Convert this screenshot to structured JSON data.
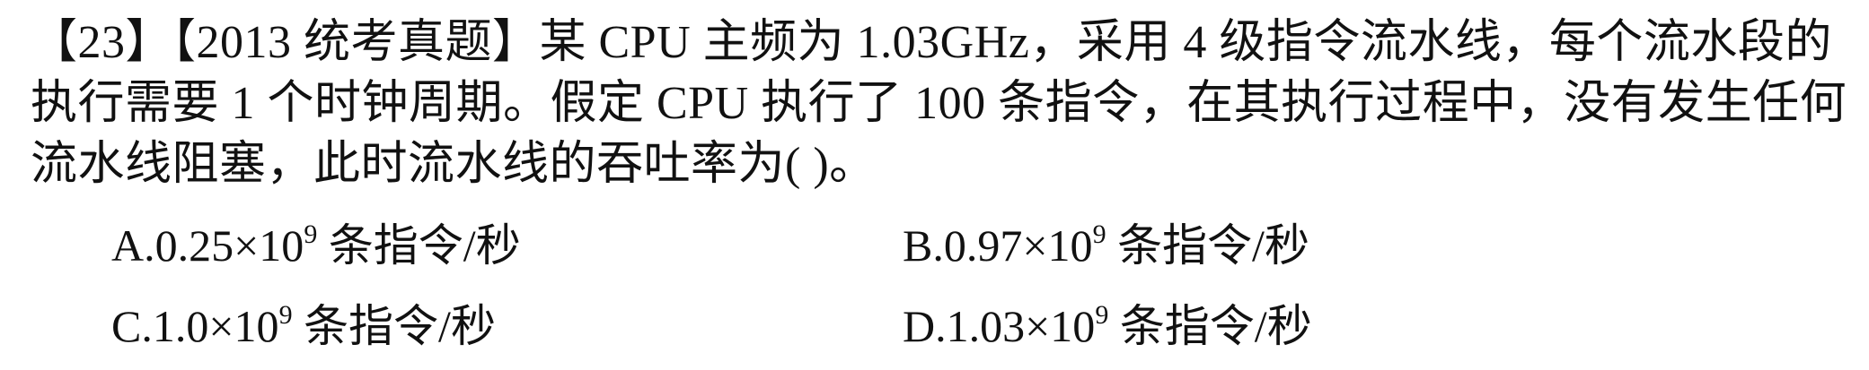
{
  "question": {
    "text": "【23】【2013 统考真题】某 CPU 主频为 1.03GHz，采用 4 级指令流水线，每个流水段的执行需要 1 个时钟周期。假定 CPU 执行了 100 条指令，在其执行过程中，没有发生任何流水线阻塞，此时流水线的吞吐率为(      )。"
  },
  "options": [
    {
      "prefix": "A.0.25×10",
      "exp": "9",
      "suffix": " 条指令/秒"
    },
    {
      "prefix": "B.0.97×10",
      "exp": "9",
      "suffix": " 条指令/秒"
    },
    {
      "prefix": "C.1.0×10",
      "exp": "9",
      "suffix": " 条指令/秒"
    },
    {
      "prefix": "D.1.03×10",
      "exp": "9",
      "suffix": " 条指令/秒"
    }
  ]
}
